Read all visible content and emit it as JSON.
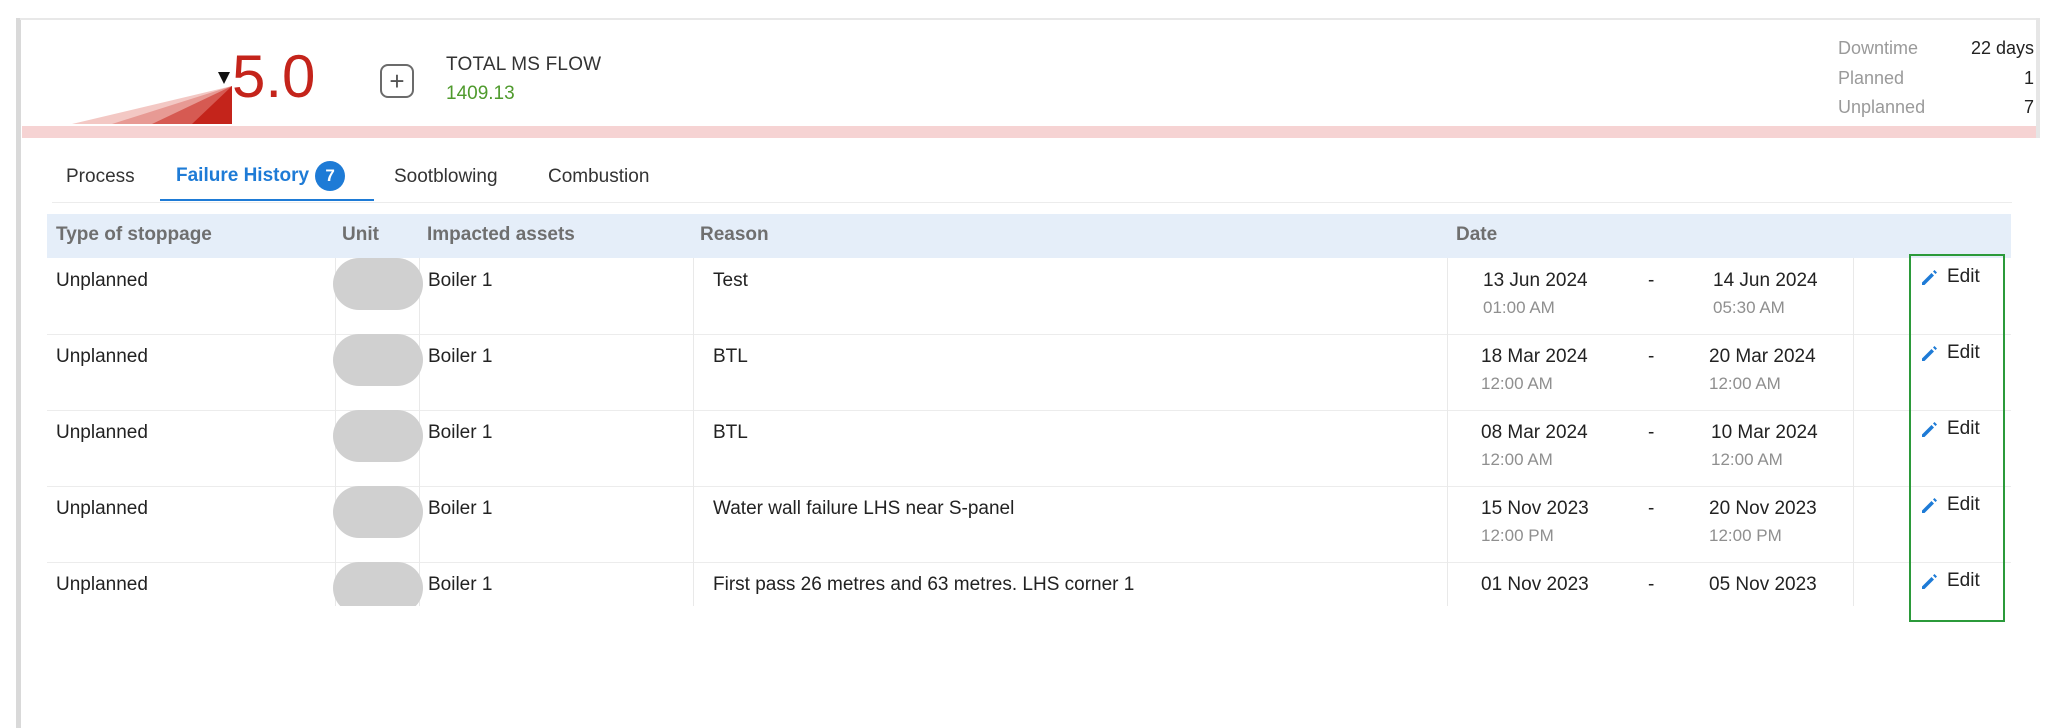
{
  "header": {
    "gauge_value": "5.0",
    "flow_title": "TOTAL MS FLOW",
    "flow_value": "1409.13",
    "stats": {
      "downtime_label": "Downtime",
      "downtime_value": "22 days",
      "planned_label": "Planned",
      "planned_value": "1",
      "unplanned_label": "Unplanned",
      "unplanned_value": "7"
    }
  },
  "tabs": [
    {
      "label": "Process"
    },
    {
      "label": "Failure History",
      "badge": "7"
    },
    {
      "label": "Sootblowing"
    },
    {
      "label": "Combustion"
    }
  ],
  "table": {
    "headers": {
      "type": "Type of stoppage",
      "unit": "Unit",
      "assets": "Impacted assets",
      "reason": "Reason",
      "date": "Date"
    },
    "edit_label": "Edit",
    "date_separator": "-",
    "rows": [
      {
        "type": "Unplanned",
        "assets": "Boiler 1",
        "reason": "Test",
        "start_date": "13 Jun 2024",
        "start_time": "01:00 AM",
        "end_date": "14 Jun 2024",
        "end_time": "05:30 AM"
      },
      {
        "type": "Unplanned",
        "assets": "Boiler 1",
        "reason": "BTL",
        "start_date": "18 Mar 2024",
        "start_time": "12:00 AM",
        "end_date": "20 Mar 2024",
        "end_time": "12:00 AM"
      },
      {
        "type": "Unplanned",
        "assets": "Boiler 1",
        "reason": "BTL",
        "start_date": "08 Mar 2024",
        "start_time": "12:00 AM",
        "end_date": "10 Mar 2024",
        "end_time": "12:00 AM"
      },
      {
        "type": "Unplanned",
        "assets": "Boiler 1",
        "reason": "Water wall failure LHS near S-panel",
        "start_date": "15 Nov 2023",
        "start_time": "12:00 PM",
        "end_date": "20 Nov 2023",
        "end_time": "12:00 PM"
      },
      {
        "type": "Unplanned",
        "assets": "Boiler 1",
        "reason": "First pass 26 metres and 63 metres. LHS corner 1",
        "start_date": "01 Nov 2023",
        "start_time": "",
        "end_date": "05 Nov 2023",
        "end_time": ""
      }
    ]
  },
  "colors": {
    "accent": "#1e7bd6",
    "gauge_red": "#c4241b",
    "flow_green": "#4f9a2d",
    "highlight_green": "#2b9a3a"
  }
}
